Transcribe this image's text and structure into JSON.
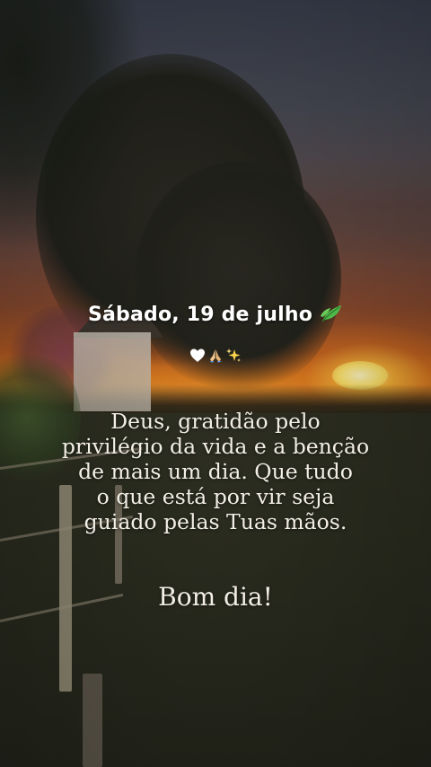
{
  "post": {
    "date": "Sábado, 19 de julho",
    "date_emoji": "leaf-icon",
    "emojis": [
      "white-heart-icon",
      "praying-hands-icon",
      "sparkles-icon"
    ],
    "message_lines": [
      "Deus, gratidão pelo",
      "privilégio da vida e a benção",
      "de mais um dia. Que tudo",
      "o que está por vir seja",
      "guiado pelas Tuas mãos."
    ],
    "greeting": "Bom dia!"
  },
  "colors": {
    "text": "#f3efe6",
    "date_text": "#ffffff",
    "sun": "#ffe36a",
    "sky_orange": "#d7791f"
  }
}
